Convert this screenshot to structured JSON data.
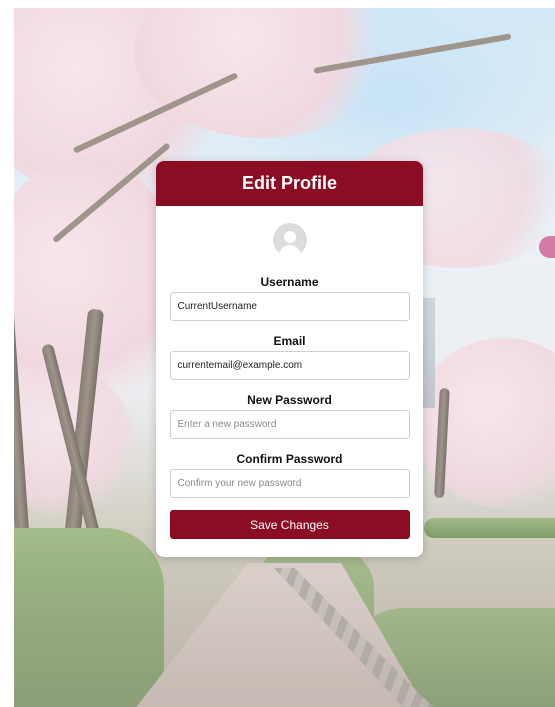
{
  "card": {
    "title": "Edit Profile",
    "avatar_icon": "user-avatar-icon"
  },
  "fields": {
    "username": {
      "label": "Username",
      "value": "CurrentUsername",
      "placeholder": ""
    },
    "email": {
      "label": "Email",
      "value": "currentemail@example.com",
      "placeholder": ""
    },
    "new_password": {
      "label": "New Password",
      "value": "",
      "placeholder": "Enter a new password"
    },
    "confirm_password": {
      "label": "Confirm Password",
      "value": "",
      "placeholder": "Confirm your new password"
    }
  },
  "actions": {
    "save_label": "Save Changes"
  },
  "colors": {
    "accent": "#8b0d24",
    "card_background": "#ffffff",
    "input_border": "#cfcfcf"
  }
}
